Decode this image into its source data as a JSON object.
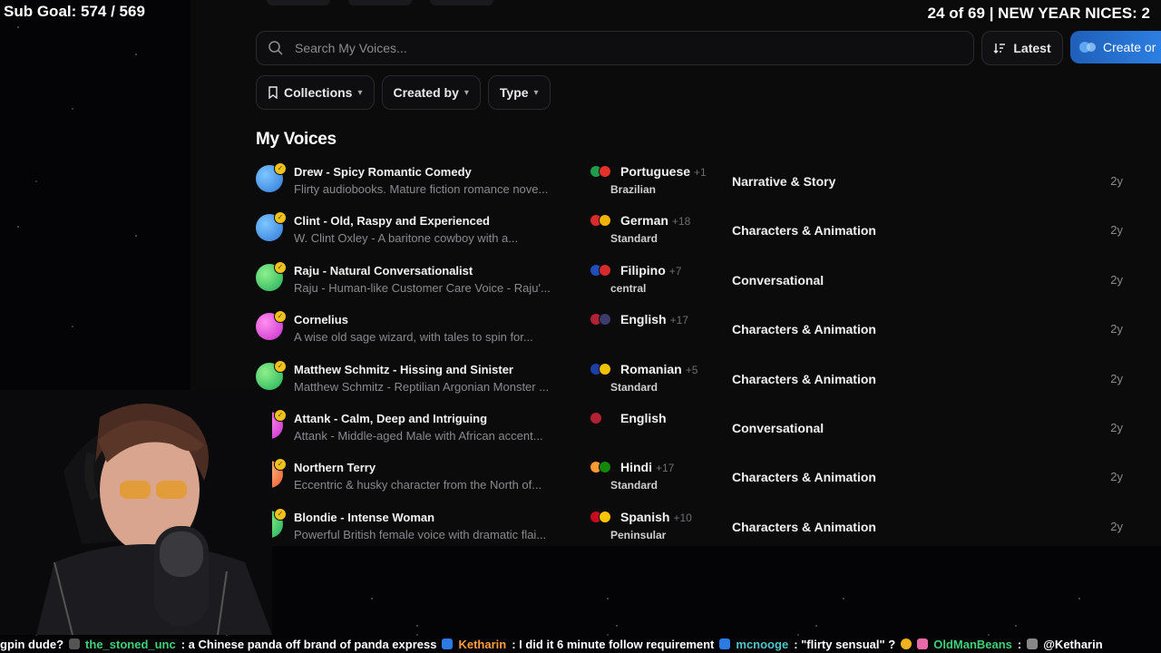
{
  "overlay": {
    "sub_goal": "Sub Goal: 574 / 569",
    "top_right": "24 of 69 | NEW YEAR NICES: 2"
  },
  "search": {
    "placeholder": "Search My Voices..."
  },
  "sort": {
    "label": "Latest"
  },
  "create": {
    "label": "Create or"
  },
  "filters": [
    {
      "label": "Collections"
    },
    {
      "label": "Created by"
    },
    {
      "label": "Type"
    }
  ],
  "section_title": "My Voices",
  "voices": [
    {
      "name": "Drew - Spicy Romantic Comedy",
      "desc": "Flirty audiobooks. Mature fiction romance nove...",
      "language": "Portuguese",
      "more": "+1",
      "accent": "Brazilian",
      "category": "Narrative & Story",
      "age": "2y",
      "avatar_colors": [
        "#2f78d8",
        "#7cc6ff"
      ],
      "flag_colors": [
        "#1e9e4a",
        "#e4322b"
      ]
    },
    {
      "name": "Clint - Old, Raspy and Experienced",
      "desc": "W. Clint Oxley - A baritone cowboy with a...",
      "language": "German",
      "more": "+18",
      "accent": "Standard",
      "category": "Characters & Animation",
      "age": "2y",
      "avatar_colors": [
        "#2f78d8",
        "#7cc6ff"
      ],
      "flag_colors": [
        "#d92b2b",
        "#f0b400"
      ]
    },
    {
      "name": "Raju - Natural Conversationalist",
      "desc": "Raju - Human-like Customer Care Voice - Raju'...",
      "language": "Filipino",
      "more": "+7",
      "accent": "central",
      "category": "Conversational",
      "age": "2y",
      "avatar_colors": [
        "#1fae5a",
        "#8ef08a"
      ],
      "flag_colors": [
        "#1f4fb8",
        "#d62b2b"
      ]
    },
    {
      "name": "Cornelius",
      "desc": "A wise old sage wizard, with tales to spin for...",
      "language": "English",
      "more": "+17",
      "accent": "",
      "category": "Characters & Animation",
      "age": "2y",
      "avatar_colors": [
        "#c52ec9",
        "#ff8ef0"
      ],
      "flag_colors": [
        "#b22234",
        "#3c3b6e"
      ]
    },
    {
      "name": "Matthew Schmitz - Hissing and Sinister",
      "desc": "Matthew Schmitz - Reptilian Argonian Monster ...",
      "language": "Romanian",
      "more": "+5",
      "accent": "Standard",
      "category": "Characters & Animation",
      "age": "2y",
      "avatar_colors": [
        "#1fae5a",
        "#8ef08a"
      ],
      "flag_colors": [
        "#1b3fa6",
        "#f2c200"
      ]
    },
    {
      "name": "Attank - Calm, Deep and Intriguing",
      "desc": "Attank - Middle-aged Male with African accent...",
      "language": "English",
      "more": "",
      "accent": "",
      "category": "Conversational",
      "age": "2y",
      "avatar_colors": [
        "#c52ec9",
        "#ff8ef0"
      ],
      "flag_colors": [
        "#b22234"
      ]
    },
    {
      "name": "Northern Terry",
      "desc": "Eccentric & husky character from the North of...",
      "language": "Hindi",
      "more": "+17",
      "accent": "Standard",
      "category": "Characters & Animation",
      "age": "2y",
      "avatar_colors": [
        "#e8562a",
        "#ffc08a"
      ],
      "flag_colors": [
        "#ff9933",
        "#138808"
      ]
    },
    {
      "name": "Blondie - Intense Woman",
      "desc": "Powerful British female voice with dramatic flai...",
      "language": "Spanish",
      "more": "+10",
      "accent": "Peninsular",
      "category": "Characters & Animation",
      "age": "2y",
      "avatar_colors": [
        "#1fae5a",
        "#8ef08a"
      ],
      "flag_colors": [
        "#c60b1e",
        "#ffc400"
      ]
    }
  ],
  "ticker": {
    "t0": "gpin dude?",
    "u1": "the_stoned_unc",
    "m1": ": a Chinese panda off brand of panda express",
    "u2": "Ketharin",
    "m2": ": I did it  6 minute follow requirement",
    "u3": "mcnooge",
    "m3": ": \"flirty sensual\" ?",
    "u4": "OldManBeans",
    "m4": ":",
    "m5": "@Ketharin"
  }
}
